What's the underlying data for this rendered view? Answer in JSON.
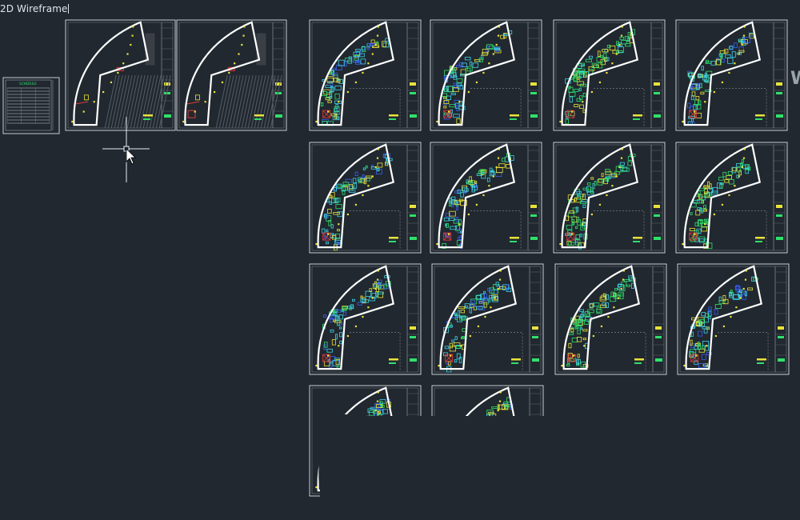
{
  "viewport": {
    "label": "2D Wireframe",
    "edge_glyph": "W"
  },
  "cursor": {
    "type": "crosshair-with-pickbox",
    "icon": "arrow-cursor-icon"
  },
  "colors": {
    "background": "#212830",
    "sheet_border": "#c8ccd0",
    "wall": "#ffffff",
    "cyan": "#3fd3e8",
    "green": "#2fe06a",
    "yellow": "#e8e23a",
    "red": "#e03a3a",
    "blue": "#3a5ff0",
    "hatch": "#555c64"
  },
  "drawing_area": {
    "schedule_sheet": {
      "header": "SCHEDULE"
    },
    "layout_sheets": [
      {
        "name": "plan-sheet-1",
        "variant": "base-plan"
      },
      {
        "name": "plan-sheet-2",
        "variant": "red-demolition"
      },
      {
        "name": "plan-sheet-3",
        "variant": "cyan-green"
      },
      {
        "name": "plan-sheet-4",
        "variant": "cyan-green"
      },
      {
        "name": "plan-sheet-5",
        "variant": "green-dense"
      },
      {
        "name": "plan-sheet-6",
        "variant": "cyan-green"
      },
      {
        "name": "plan-sheet-7",
        "variant": "cyan-green"
      },
      {
        "name": "plan-sheet-8",
        "variant": "cyan-green"
      },
      {
        "name": "plan-sheet-9",
        "variant": "green-dense"
      },
      {
        "name": "plan-sheet-10",
        "variant": "green-dense"
      },
      {
        "name": "plan-sheet-11",
        "variant": "cyan-green"
      },
      {
        "name": "plan-sheet-12",
        "variant": "cyan-green"
      },
      {
        "name": "plan-sheet-13",
        "variant": "green-dense"
      },
      {
        "name": "plan-sheet-14",
        "variant": "cyan-green"
      },
      {
        "name": "plan-sheet-15",
        "variant": "cyan-green"
      },
      {
        "name": "plan-sheet-16",
        "variant": "cyan-green"
      }
    ]
  }
}
